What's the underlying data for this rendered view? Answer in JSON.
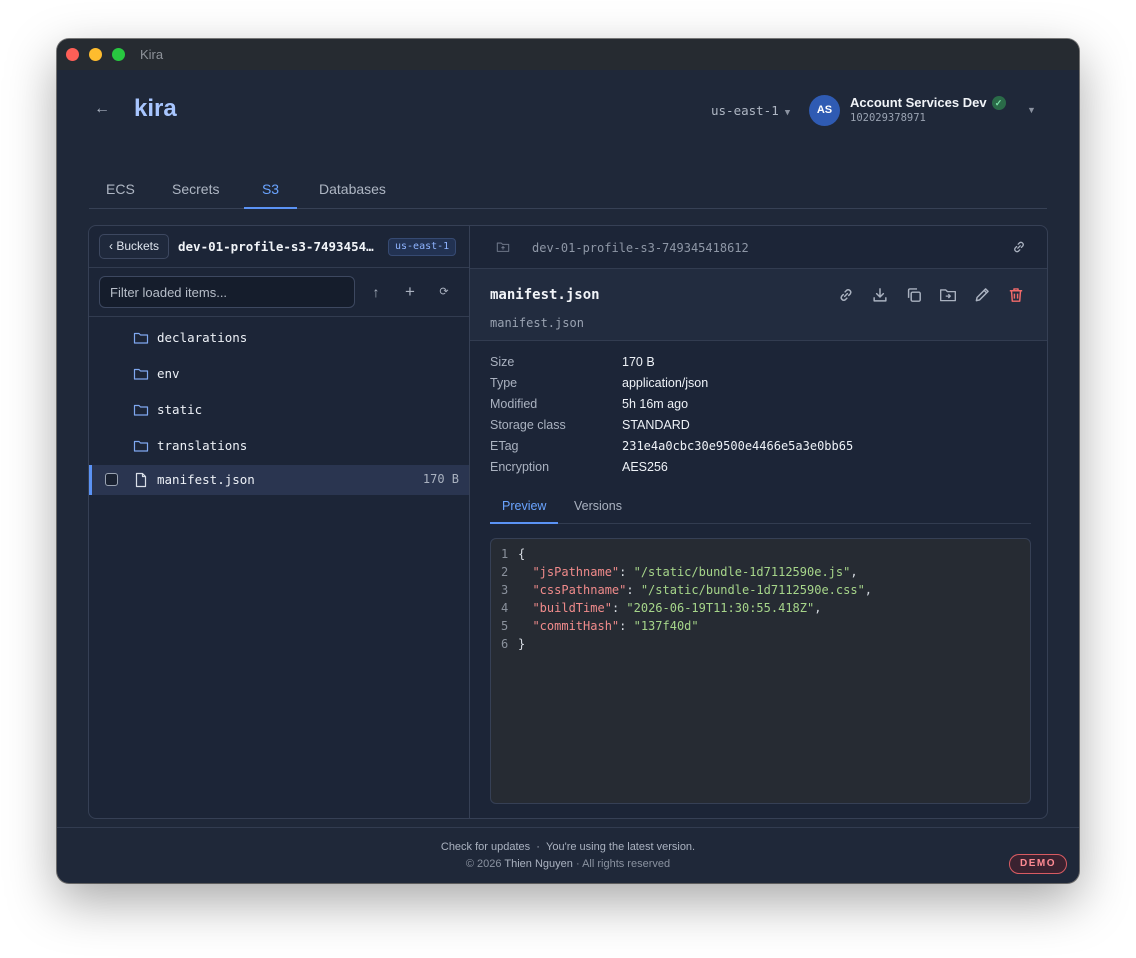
{
  "window": {
    "title": "Kira"
  },
  "header": {
    "app_name": "kira",
    "region": "us-east-1",
    "account": {
      "initials": "AS",
      "name": "Account Services Dev",
      "id": "102029378971"
    }
  },
  "tabs": [
    {
      "label": "ECS"
    },
    {
      "label": "Secrets"
    },
    {
      "label": "S3",
      "active": true
    },
    {
      "label": "Databases"
    }
  ],
  "left": {
    "buckets_label": "‹ Buckets",
    "bucket_name": "dev-01-profile-s3-749345418612",
    "region_badge": "us-east-1",
    "filter_placeholder": "Filter loaded items...",
    "items": [
      {
        "name": "declarations",
        "type": "folder"
      },
      {
        "name": "env",
        "type": "folder"
      },
      {
        "name": "static",
        "type": "folder"
      },
      {
        "name": "translations",
        "type": "folder"
      },
      {
        "name": "manifest.json",
        "type": "file",
        "size": "170 B",
        "selected": true
      }
    ]
  },
  "right": {
    "path": "dev-01-profile-s3-749345418612",
    "file_name": "manifest.json",
    "file_key": "manifest.json",
    "meta": {
      "size_label": "Size",
      "size": "170 B",
      "type_label": "Type",
      "type": "application/json",
      "modified_label": "Modified",
      "modified": "5h 16m ago",
      "storage_label": "Storage class",
      "storage": "STANDARD",
      "etag_label": "ETag",
      "etag": "231e4a0cbc30e9500e4466e5a3e0bb65",
      "encryption_label": "Encryption",
      "encryption": "AES256"
    },
    "sub_tabs": {
      "preview": "Preview",
      "versions": "Versions"
    },
    "code": {
      "l1": "1",
      "l2": "2",
      "l3": "3",
      "l4": "4",
      "l5": "5",
      "l6": "6",
      "open": "{",
      "close": "}",
      "k1": "\"jsPathname\"",
      "v1": "\"/static/bundle-1d7112590e.js\"",
      "k2": "\"cssPathname\"",
      "v2": "\"/static/bundle-1d7112590e.css\"",
      "k3": "\"buildTime\"",
      "v3": "\"2026-06-19T11:30:55.418Z\"",
      "k4": "\"commitHash\"",
      "v4": "\"137f40d\""
    }
  },
  "footer": {
    "check_updates": "Check for updates",
    "status": "You're using the latest version.",
    "copyright": "© 2026",
    "author": "Thien Nguyen",
    "rights": "· All rights reserved",
    "badge": "DEMO"
  },
  "colors": {
    "accent": "#5b93f5",
    "background": "#1f2839",
    "danger": "#f06a6a",
    "success": "#28c840"
  }
}
